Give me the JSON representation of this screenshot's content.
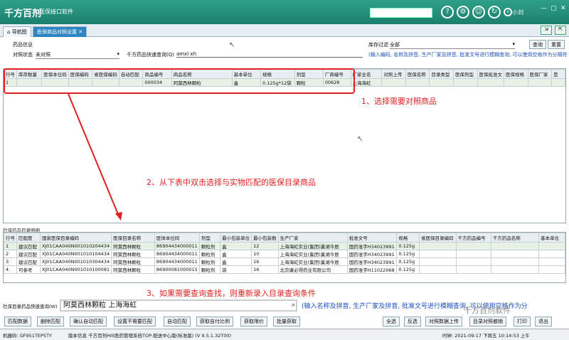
{
  "app": {
    "logo_text": "千方百剂",
    "title": "医保接口软件",
    "user": "小刘",
    "icons": [
      "help-icon",
      "settings-icon",
      "user-icon",
      "refresh-icon",
      "power-icon"
    ],
    "accent": "#1b7f6d"
  },
  "tabs": [
    {
      "label": "导航图",
      "active": false
    },
    {
      "label": "医保商品对照设置",
      "active": true
    }
  ],
  "filter": {
    "drug_info_label": "药品信息",
    "compare_status_label": "对照状态",
    "compare_status_value": "未对照",
    "quick_query_label": "千方药品快速查询(Q)",
    "quick_query_value": "amxl xh",
    "stock_filter_label": "库存过滤",
    "stock_filter_value": "全部",
    "query_button": "查询",
    "reset_button": "重置",
    "hint": "(输入编码, 名称及拼音, 生产厂家及拼音, 批准文号进行模糊查询, 可以使用空格作为分隔符进行"
  },
  "top_table": {
    "headers": [
      "行号",
      "库存数量",
      "医保本位码",
      "医保编码",
      "省医保编码",
      "自动匹配",
      "商品编号",
      "商品名称",
      "基本单位",
      "规格",
      "剂型",
      "厂商编号",
      "厂家全名",
      "对照上传",
      "医保名称",
      "目录类型",
      "医保剂型",
      "医保批准文",
      "医保规格",
      "医保厂家",
      "是"
    ],
    "rows": [
      [
        "1",
        "",
        "",
        "",
        "",
        "",
        "000034",
        "阿莫西林颗粒",
        "盒",
        "0.125g*12袋",
        "颗粒",
        "00626",
        "上海海虹",
        "",
        "",
        "",
        "",
        "",
        "",
        "",
        ""
      ]
    ]
  },
  "annotations": {
    "a1": "1、选择需要对照商品",
    "a2": "2、从下表中双击选择与实物匹配的医保目录商品",
    "a3": "3、如果需要查询查找，则重新录入目录查询条件"
  },
  "bottom_section_label": "社保药品目录明细",
  "bottom_table": {
    "headers": [
      "行号",
      "匹配度",
      "国家医保目录编码",
      "医保目录名称",
      "医体本位码",
      "剂型",
      "最小包装单位",
      "最小包装数",
      "生产厂家",
      "批准文号",
      "规格",
      "省医保目录编码",
      "千方药品编号",
      "千方药品名称",
      "基本单位"
    ],
    "rows": [
      [
        "1",
        "建议匹配",
        "XJ01CAA040N001010204434",
        "阿莫西林颗粒",
        "86904434000011",
        "颗粒剂",
        "盒",
        "12",
        "上海海虹实业(集团)巢湖今辰",
        "国药准字H34023991",
        "0.125g",
        "",
        "",
        "",
        ""
      ],
      [
        "2",
        "建议匹配",
        "XJ01CAA040N001010104434",
        "阿莫西林颗粒",
        "86904434000011",
        "颗粒剂",
        "盒",
        "10",
        "上海海虹实业(集团)巢湖今辰",
        "国药准字H34023991",
        "0.125g",
        "",
        "",
        "",
        ""
      ],
      [
        "3",
        "建议匹配",
        "XJ01CAA040N001010304434",
        "阿莫西林颗粒",
        "86904434000011",
        "颗粒剂",
        "盒",
        "16",
        "上海海虹实业(集团)巢湖今辰",
        "国药准字H34023991",
        "0.125g",
        "",
        "",
        "",
        ""
      ],
      [
        "4",
        "可参考",
        "XJ01CAA040N001010100081",
        "阿莫西林颗粒",
        "86900081000015",
        "颗粒剂",
        "袋",
        "16",
        "北京康必得药业有限公司",
        "国药准字H11022068",
        "0.125g",
        "",
        "",
        "",
        ""
      ]
    ]
  },
  "bottom_search": {
    "label": "社保目录药品快速查询(W)",
    "value": "阿莫西林颗粒 上海海虹",
    "hint": "(输入名称及拼音, 生产厂家及拼音, 批准文号进行模糊查询, 可以使用空格作为分"
  },
  "bottom_buttons_left": [
    "匹配数据",
    "删除匹配",
    "确认自动匹配",
    "设置不需要匹配",
    "自动匹配",
    "获取自付比例",
    "获取限价",
    "批量获取"
  ],
  "bottom_buttons_right": [
    "全选",
    "反选",
    "对照数据上传",
    "目录对照撤销",
    "打印",
    "退出"
  ],
  "status": {
    "machine": "机器码: GF951TEP5TY",
    "version": "版本信息 千方百剂HIS医药管理系统TOP-配送中心版(标准版) (V 9.5.1.32T00)",
    "time": "时钟: 2021-09-17 下周五 10:14:53 上午"
  },
  "watermark": "千方百剂软件"
}
